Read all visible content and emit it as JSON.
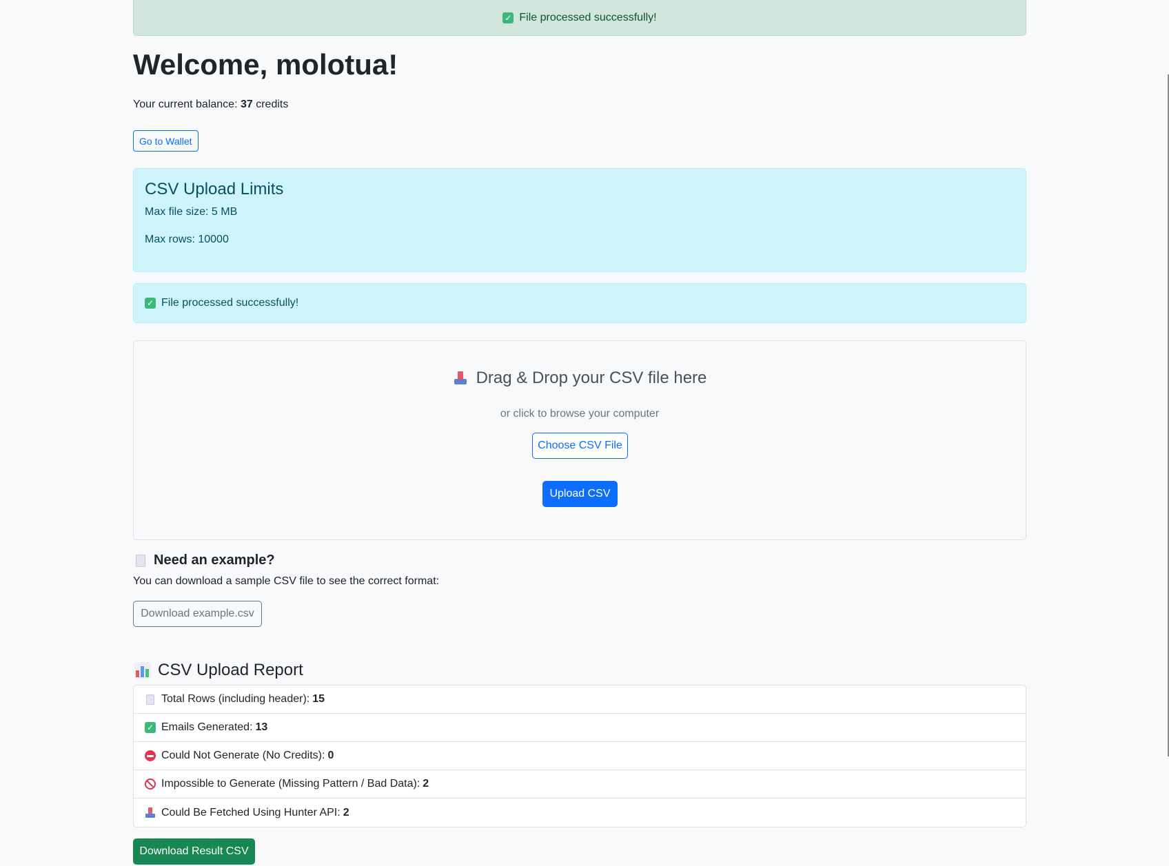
{
  "top_alert": {
    "icon": "check-mark-icon",
    "text": "File processed successfully!"
  },
  "welcome": {
    "title": "Welcome, molotua!"
  },
  "balance": {
    "prefix": "Your current balance:",
    "amount": "37",
    "suffix": "credits"
  },
  "wallet_button": "Go to Wallet",
  "limits": {
    "title": "CSV Upload Limits",
    "max_size": "Max file size: 5 MB",
    "max_rows": "Max rows: 10000"
  },
  "info_alert": {
    "icon": "check-mark-icon",
    "text": "File processed successfully!"
  },
  "dropzone": {
    "icon": "inbox-tray-icon",
    "title": "Drag & Drop your CSV file here",
    "subtitle": "or click to browse your computer",
    "choose_label": "Choose CSV File",
    "upload_label": "Upload CSV"
  },
  "example": {
    "icon": "document-icon",
    "title": "Need an example?",
    "text": "You can download a sample CSV file to see the correct format:",
    "button": "Download example.csv"
  },
  "report": {
    "icon": "bar-chart-icon",
    "title": "CSV Upload Report",
    "items": [
      {
        "icon": "document-icon",
        "label": "Total Rows (including header):",
        "value": "15"
      },
      {
        "icon": "check-mark-icon",
        "label": "Emails Generated:",
        "value": "13"
      },
      {
        "icon": "no-entry-icon",
        "label": "Could Not Generate (No Credits):",
        "value": "0"
      },
      {
        "icon": "prohibited-icon",
        "label": "Impossible to Generate (Missing Pattern / Bad Data):",
        "value": "2"
      },
      {
        "icon": "inbox-tray-icon",
        "label": "Could Be Fetched Using Hunter API:",
        "value": "2"
      }
    ],
    "download_button": "Download Result CSV"
  },
  "colors": {
    "primary": "#0d6efd",
    "success": "#198754",
    "info_bg": "#cff4fc",
    "success_bg": "#d1e7dd"
  }
}
